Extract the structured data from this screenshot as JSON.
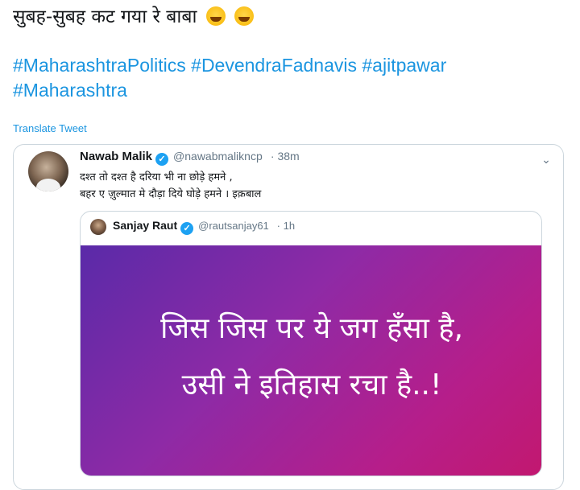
{
  "tweet": {
    "text": "सुबह-सुबह कट गया रे बाबा",
    "emojis": [
      "rolling-on-floor-laughing-emoji",
      "tears-of-joy-emoji"
    ],
    "hashtags_line1": [
      "#MaharashtraPolitics",
      "#DevendraFadnavis",
      "#ajitpawar"
    ],
    "hashtags_line2": [
      "#Maharashtra"
    ],
    "translate_label": "Translate Tweet"
  },
  "quoted": {
    "name": "Nawab Malik",
    "handle": "@nawabmalikncp",
    "time": "· 38m",
    "line1": "दश्त तो दश्त है दरिया भी ना छोड़े हमने ,",
    "line2": "बहर ए ज़ुल्मात मे दौड़ा दिये घोड़े हमने । इक़बाल",
    "menu_icon": "chevron-down-icon",
    "nested": {
      "name": "Sanjay Raut",
      "handle": "@rautsanjay61",
      "time": "· 1h",
      "image_line1": "जिस जिस पर ये जग हँसा है,",
      "image_line2": "उसी ने इतिहास रचा है..!"
    }
  },
  "colors": {
    "link": "#1b95e0",
    "verified": "#1da1f2",
    "gradient_start": "#5a2aa8",
    "gradient_end": "#c2186f"
  }
}
